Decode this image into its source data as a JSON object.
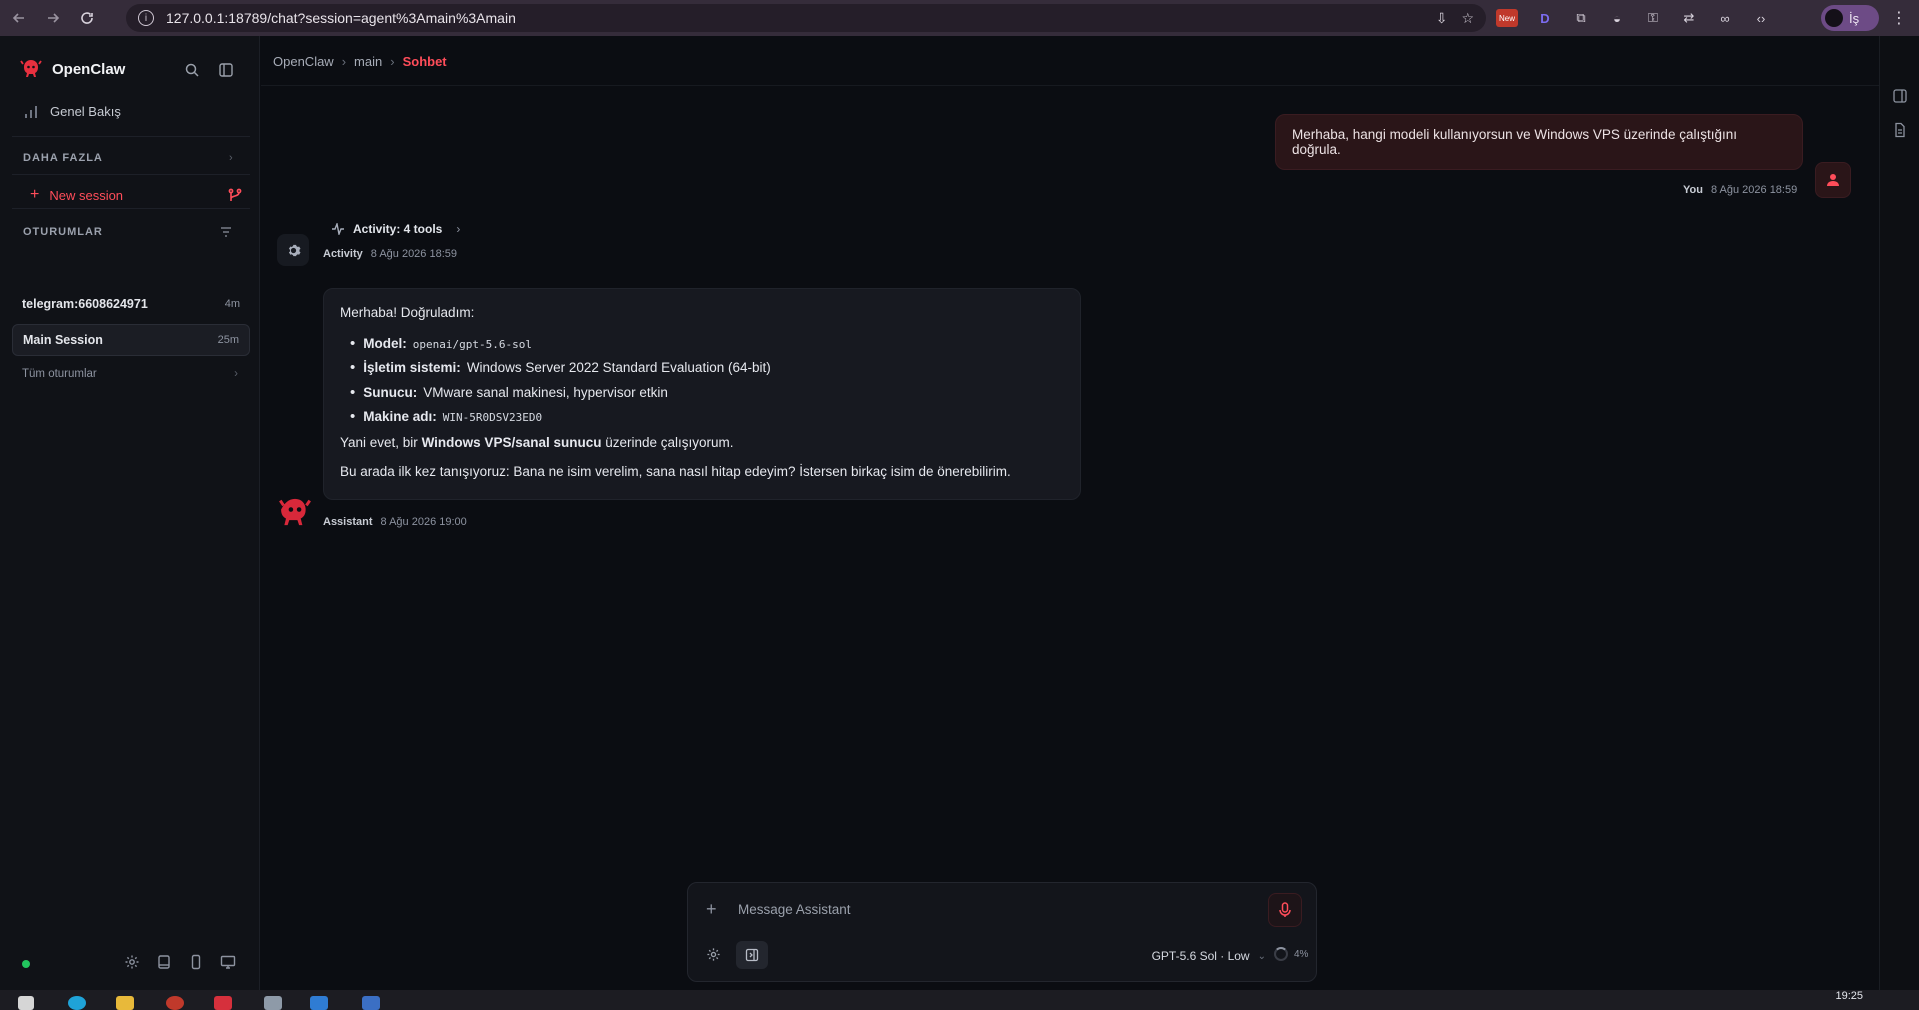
{
  "browser": {
    "url": "127.0.0.1:18789/chat?session=agent%3Amain%3Amain",
    "profile_label": "İş",
    "ext_new_badge": "New",
    "ext_d_label": "D"
  },
  "sidebar": {
    "brand": "OpenClaw",
    "overview": "Genel Bakış",
    "more_section": "DAHA FAZLA",
    "new_session": "New session",
    "sessions_section": "OTURUMLAR",
    "sessions": [
      {
        "name": "telegram:6608624971",
        "age": "4m"
      },
      {
        "name": "Main Session",
        "age": "25m"
      }
    ],
    "all_sessions": "Tüm oturumlar"
  },
  "breadcrumb": {
    "items": [
      "OpenClaw",
      "main"
    ],
    "current": "Sohbet",
    "separator": "›"
  },
  "chat": {
    "user_message": "Merhaba, hangi modeli kullanıyorsun ve Windows VPS üzerinde çalıştığını doğrula.",
    "user_name": "You",
    "user_time": "8 Ağu 2026 18:59",
    "activity_label": "Activity: 4 tools",
    "activity_name": "Activity",
    "activity_time": "8 Ağu 2026 18:59",
    "assistant": {
      "greeting": "Merhaba! Doğruladım:",
      "items": [
        {
          "label": "Model:",
          "value": "openai/gpt-5.6-sol"
        },
        {
          "label": "İşletim sistemi:",
          "value": "Windows Server 2022 Standard Evaluation (64-bit)"
        },
        {
          "label": "Sunucu:",
          "value": "VMware sanal makinesi, hypervisor etkin"
        },
        {
          "label": "Makine adı:",
          "value": "WIN-5R0DSV23ED0"
        }
      ],
      "summary_pre": "Yani evet, bir",
      "summary_bold": "Windows VPS/sanal sunucu",
      "summary_post": "üzerinde çalışıyorum.",
      "closing": "Bu arada ilk kez tanışıyoruz: Bana ne isim verelim, sana nasıl hitap edeyim? İstersen birkaç isim de önerebilirim."
    },
    "assistant_name": "Assistant",
    "assistant_time": "8 Ağu 2026 19:00"
  },
  "composer": {
    "placeholder": "Message Assistant",
    "model": "GPT-5.6 Sol · Low",
    "context_usage": "4%"
  },
  "taskbar": {
    "clock": "19:25"
  },
  "colors": {
    "accent": "#ff4d5a",
    "status_online": "#22c55e",
    "user_bubble": "#2a1518",
    "assistant_bubble": "#171920"
  }
}
